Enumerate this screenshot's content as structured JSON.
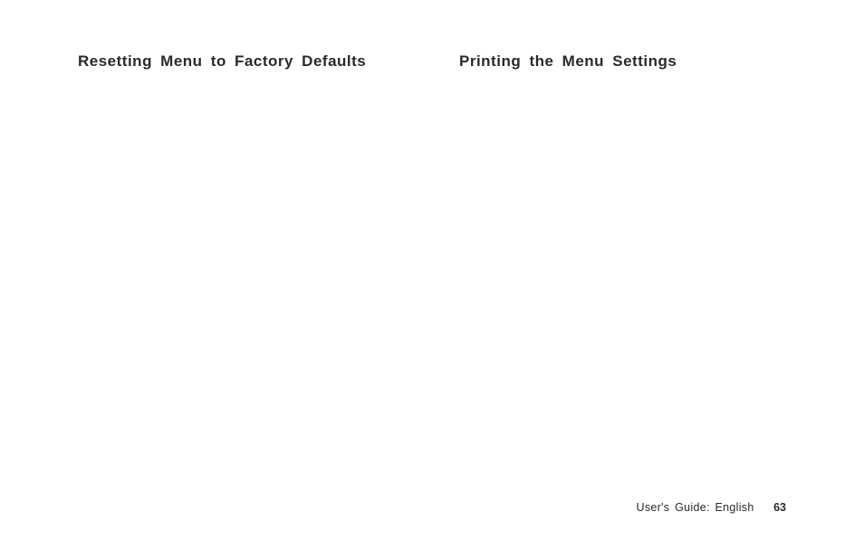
{
  "columns": {
    "left": {
      "heading": "Resetting Menu to Factory Defaults"
    },
    "right": {
      "heading": "Printing the Menu Settings"
    }
  },
  "footer": {
    "label": "User's Guide:  English",
    "page_number": "63"
  }
}
